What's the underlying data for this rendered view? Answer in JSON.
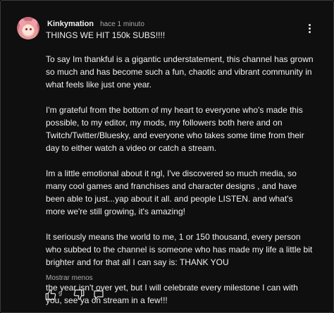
{
  "comment": {
    "author": "Kinkymation",
    "timestamp": "hace 1 minuto",
    "paragraphs": [
      "THINGS WE HIT 150k SUBS!!!!",
      "To say Im thankful is a gigantic understatement, this channel has grown so much and has become such a fun, chaotic and vibrant community in what feels like just one year.",
      "I'm grateful from the bottom of my heart to everyone who's made this possible, to my editor, my mods, my followers both here and on Twitch/Twitter/Bluesky, and everyone who takes some time from their day to either watch a video or catch a stream.",
      "Im a little emotional about it ngl, I've discovered so much media, so many cool games and franchises and character designs , and have been able to just...yap about it all. and people LISTEN. and what's more we're still growing, it's amazing!",
      "It seriously means the world to me, 1 or 150 thousand, every person who subbed to  the channel is someone who has made my life a little bit brighter and for that all I can say is: THANK YOU",
      "the year isn't over yet, but I will celebrate every milestone I can with you, see ya on stream in a few!!!"
    ],
    "show_less_label": "Mostrar menos",
    "like_count": "9"
  },
  "icons": {
    "avatar": "avatar-image",
    "more": "more-vert-icon",
    "like": "thumb-up-icon",
    "dislike": "thumb-down-icon",
    "reply": "reply-icon"
  },
  "colors": {
    "background": "#0f0f0f",
    "text": "#f1f1f1",
    "secondary_text": "#aaaaaa"
  }
}
